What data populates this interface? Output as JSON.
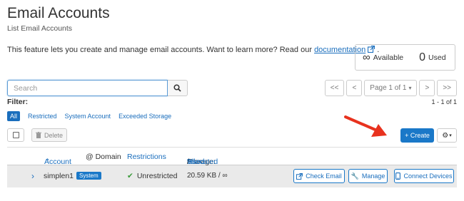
{
  "header": {
    "title": "Email Accounts",
    "subtitle": "List Email Accounts",
    "intro_text": "This feature lets you create and manage email accounts. Want to learn more? Read our",
    "intro_link": "documentation",
    "intro_end": "."
  },
  "stats": {
    "available_symbol": "∞",
    "available_label": "Available",
    "used_count": "0",
    "used_label": "Used"
  },
  "search": {
    "placeholder": "Search",
    "icon": "search-icon"
  },
  "pagination": {
    "first": "<<",
    "prev": "<",
    "page_label": "Page 1 of 1",
    "next": ">",
    "last": ">>",
    "range": "1 - 1 of 1"
  },
  "filter": {
    "label": "Filter:",
    "options": [
      "All",
      "Restricted",
      "System Account",
      "Exceeded Storage"
    ],
    "active": "All"
  },
  "toolbar": {
    "delete_label": "Delete",
    "create_label": "+ Create"
  },
  "table": {
    "headers": {
      "account": "Account",
      "at_domain": "@ Domain",
      "restrictions": "Restrictions",
      "storage_prefix": "Storage:",
      "used": "Used",
      "sep1": "/",
      "allocated": "Allocated",
      "sep2": "/",
      "percent": "%"
    },
    "rows": [
      {
        "account": "simplen1",
        "badge": "System",
        "restriction": "Unrestricted",
        "storage": "20.59 KB / ∞",
        "actions": [
          "Check Email",
          "Manage",
          "Connect Devices"
        ]
      }
    ]
  },
  "colors": {
    "accent": "#1a78c8",
    "link": "#1a6ebd",
    "arrow": "#e8321e",
    "success": "#3a9a3a"
  }
}
